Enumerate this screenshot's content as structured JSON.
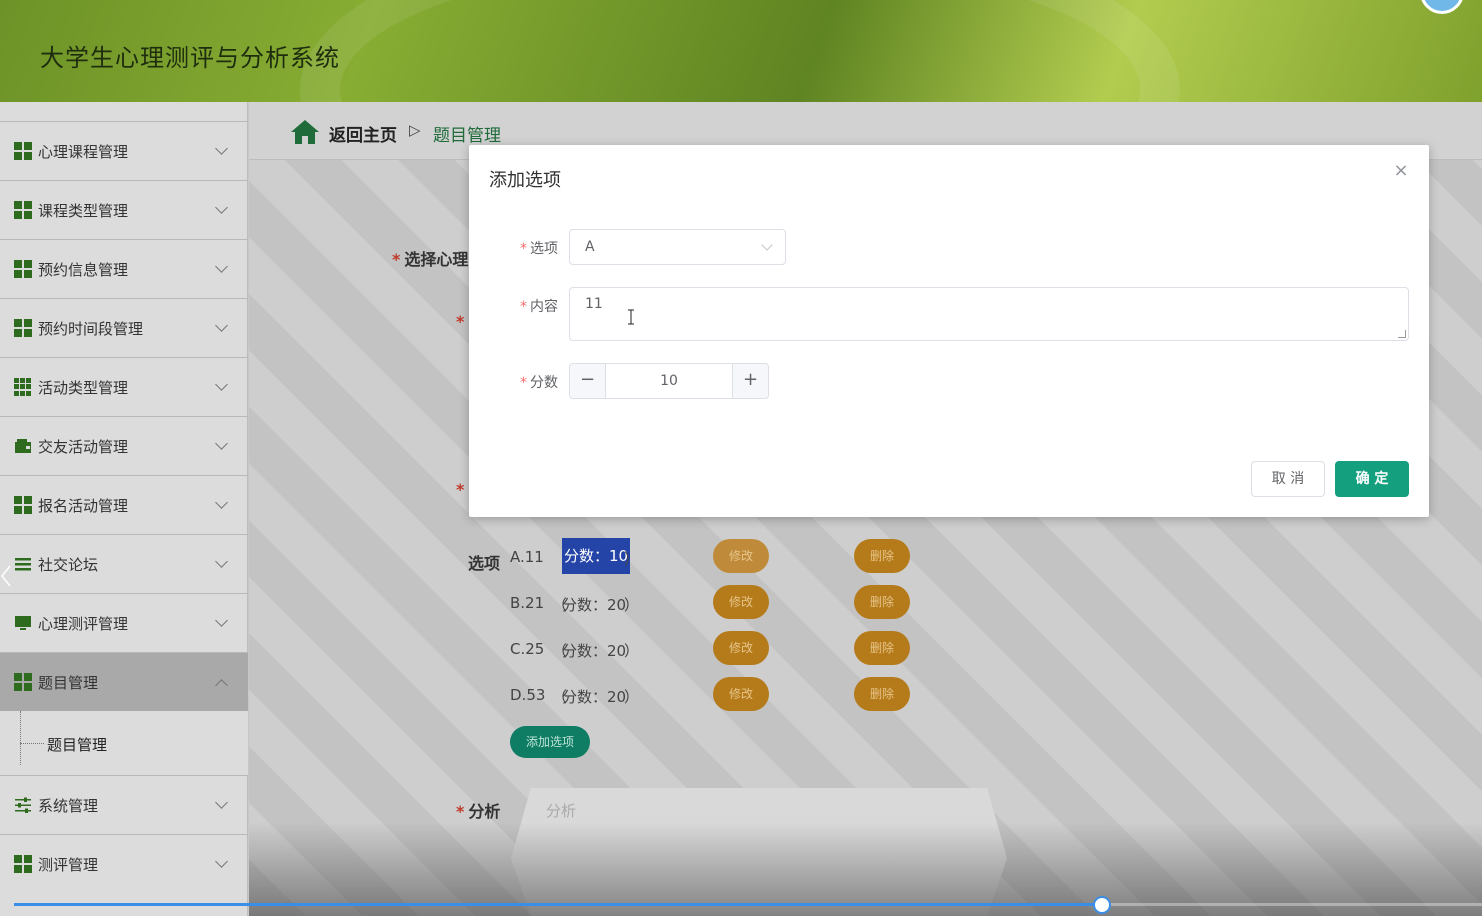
{
  "app": {
    "title": "大学生心理测评与分析系统"
  },
  "sidebar": {
    "items": [
      {
        "label": "心理课程管理",
        "icon": "grid-icon"
      },
      {
        "label": "课程类型管理",
        "icon": "grid-icon"
      },
      {
        "label": "预约信息管理",
        "icon": "grid-icon"
      },
      {
        "label": "预约时间段管理",
        "icon": "grid-icon"
      },
      {
        "label": "活动类型管理",
        "icon": "apps-icon"
      },
      {
        "label": "交友活动管理",
        "icon": "wallet-icon"
      },
      {
        "label": "报名活动管理",
        "icon": "grid-icon"
      },
      {
        "label": "社交论坛",
        "icon": "list-icon"
      },
      {
        "label": "心理测评管理",
        "icon": "monitor-icon"
      },
      {
        "label": "题目管理",
        "icon": "grid-icon",
        "expanded": true
      },
      {
        "label": "系统管理",
        "icon": "sliders-icon"
      },
      {
        "label": "测评管理",
        "icon": "grid-icon"
      }
    ],
    "submenu": {
      "label": "题目管理"
    }
  },
  "breadcrumb": {
    "home": "返回主页",
    "separator": "▷",
    "current": "题目管理"
  },
  "form": {
    "select_label": "选择心理",
    "options_label": "选项",
    "analysis_label": "分析",
    "analysis_placeholder": "分析",
    "options": [
      {
        "text": "A.11",
        "score_prefix": "（",
        "score": "分数：10",
        "score_suffix": "）",
        "edit": "修改",
        "delete": "删除"
      },
      {
        "text": "B.21",
        "score_prefix": "（",
        "score": "分数：20",
        "score_suffix": "）",
        "edit": "修改",
        "delete": "删除"
      },
      {
        "text": "C.25",
        "score_prefix": "（",
        "score": "分数：20",
        "score_suffix": "）",
        "edit": "修改",
        "delete": "删除"
      },
      {
        "text": "D.53",
        "score_prefix": "（",
        "score": "分数：20",
        "score_suffix": "）",
        "edit": "修改",
        "delete": "删除"
      }
    ],
    "add_option": "添加选项"
  },
  "dialog": {
    "title": "添加选项",
    "close": "×",
    "option_label": "选项",
    "option_value": "A",
    "content_label": "内容",
    "content_value": "11",
    "score_label": "分数",
    "score_value": "10",
    "decrement": "−",
    "increment": "+",
    "cancel": "取 消",
    "confirm": "确 定"
  },
  "player": {
    "progress": 0.741
  },
  "colors": {
    "accent": "#14a07f",
    "brand_green": "#6d9227",
    "pill": "#b57a1a",
    "highlight": "#2444a8"
  }
}
